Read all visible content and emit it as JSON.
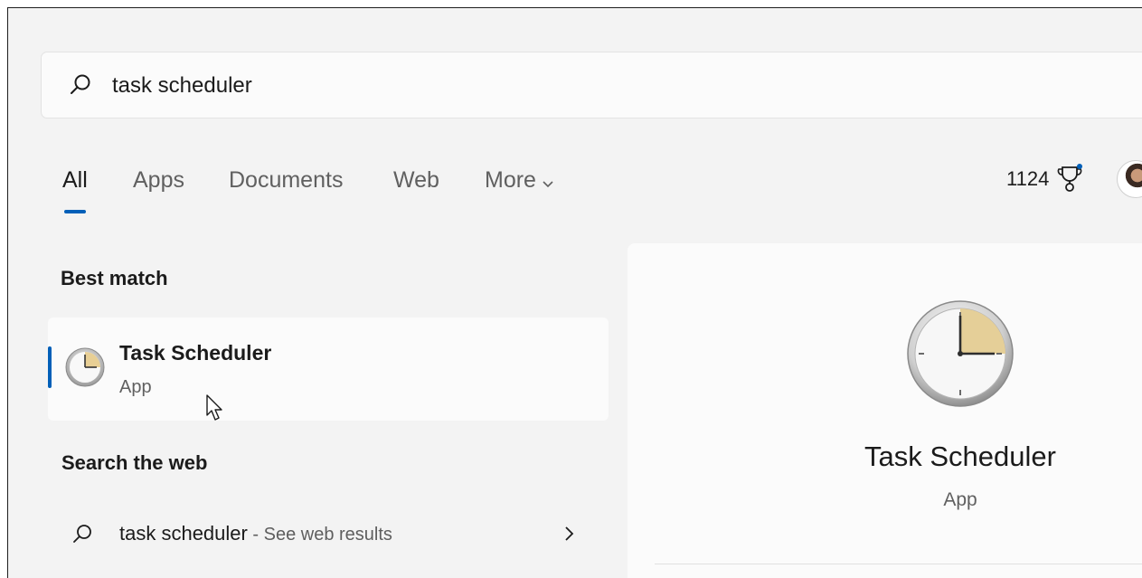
{
  "search": {
    "query": "task scheduler"
  },
  "tabs": [
    {
      "label": "All",
      "active": true
    },
    {
      "label": "Apps"
    },
    {
      "label": "Documents"
    },
    {
      "label": "Web"
    },
    {
      "label": "More"
    }
  ],
  "rewards": {
    "points": "1124"
  },
  "best_match": {
    "heading": "Best match",
    "title": "Task Scheduler",
    "subtitle": "App"
  },
  "search_web": {
    "heading": "Search the web",
    "query": "task scheduler",
    "hint": " - See web results"
  },
  "preview": {
    "title": "Task Scheduler",
    "subtitle": "App"
  },
  "colors": {
    "accent": "#005fb8",
    "background": "#f3f3f3",
    "card": "#fbfbfb"
  }
}
